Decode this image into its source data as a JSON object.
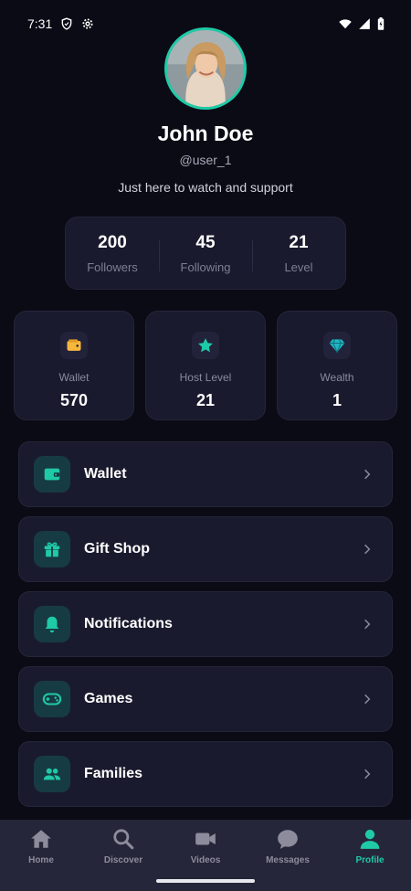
{
  "status_bar": {
    "time": "7:31",
    "icons": [
      "shield-icon",
      "settings-icon",
      "wifi-icon",
      "signal-icon",
      "battery-icon"
    ]
  },
  "profile": {
    "name": "John Doe",
    "handle": "@user_1",
    "bio": "Just here to watch and support",
    "accent_color": "#1fcaa7"
  },
  "stats": [
    {
      "value": "200",
      "label": "Followers"
    },
    {
      "value": "45",
      "label": "Following"
    },
    {
      "value": "21",
      "label": "Level"
    }
  ],
  "tiles": [
    {
      "label": "Wallet",
      "value": "570",
      "icon": "wallet-icon",
      "icon_color": "#f5b83d"
    },
    {
      "label": "Host Level",
      "value": "21",
      "icon": "star-icon",
      "icon_color": "#1fcaa7"
    },
    {
      "label": "Wealth",
      "value": "1",
      "icon": "diamond-icon",
      "icon_color": "#1fb5c4"
    }
  ],
  "menu": [
    {
      "label": "Wallet",
      "icon": "wallet-icon"
    },
    {
      "label": "Gift Shop",
      "icon": "gift-icon"
    },
    {
      "label": "Notifications",
      "icon": "bell-icon"
    },
    {
      "label": "Games",
      "icon": "gamepad-icon"
    },
    {
      "label": "Families",
      "icon": "users-icon"
    }
  ],
  "bottom_nav": [
    {
      "label": "Home",
      "icon": "home-icon",
      "active": false
    },
    {
      "label": "Discover",
      "icon": "search-icon",
      "active": false
    },
    {
      "label": "Videos",
      "icon": "video-icon",
      "active": false
    },
    {
      "label": "Messages",
      "icon": "chat-icon",
      "active": false
    },
    {
      "label": "Profile",
      "icon": "person-icon",
      "active": true
    }
  ]
}
